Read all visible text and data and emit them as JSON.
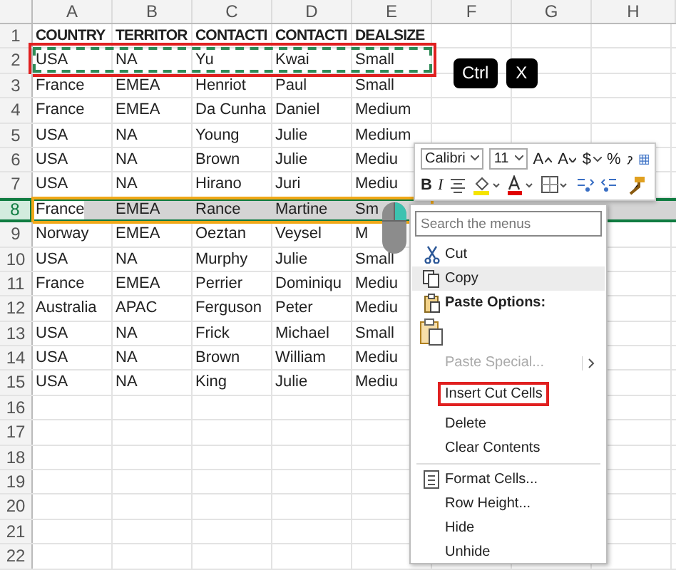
{
  "sheet": {
    "columns": [
      "A",
      "B",
      "C",
      "D",
      "E",
      "F",
      "G",
      "H"
    ],
    "header_row": {
      "number": "1",
      "cells": [
        "COUNTRY",
        "TERRITOR",
        "CONTACTI",
        "CONTACTI",
        "DEALSIZE"
      ]
    },
    "rows": [
      {
        "number": "2",
        "selected": false,
        "cut": true,
        "outlined": false,
        "cells": [
          "USA",
          "NA",
          "Yu",
          "Kwai",
          "Small"
        ]
      },
      {
        "number": "3",
        "selected": false,
        "cut": false,
        "outlined": false,
        "cells": [
          "France",
          "EMEA",
          "Henriot",
          "Paul",
          "Small"
        ]
      },
      {
        "number": "4",
        "selected": false,
        "cut": false,
        "outlined": false,
        "cells": [
          "France",
          "EMEA",
          "Da Cunha",
          "Daniel",
          "Medium"
        ]
      },
      {
        "number": "5",
        "selected": false,
        "cut": false,
        "outlined": false,
        "cells": [
          "USA",
          "NA",
          "Young",
          "Julie",
          "Medium"
        ]
      },
      {
        "number": "6",
        "selected": false,
        "cut": false,
        "outlined": false,
        "cells": [
          "USA",
          "NA",
          "Brown",
          "Julie",
          "Mediu"
        ]
      },
      {
        "number": "7",
        "selected": false,
        "cut": false,
        "outlined": false,
        "cells": [
          "USA",
          "NA",
          "Hirano",
          "Juri",
          "Mediu"
        ]
      },
      {
        "number": "8",
        "selected": true,
        "cut": false,
        "outlined": true,
        "cells": [
          "France",
          "EMEA",
          "Rance",
          "Martine",
          "Sm"
        ]
      },
      {
        "number": "9",
        "selected": false,
        "cut": false,
        "outlined": false,
        "cells": [
          "Norway",
          "EMEA",
          "Oeztan",
          "Veysel",
          "M"
        ]
      },
      {
        "number": "10",
        "selected": false,
        "cut": false,
        "outlined": false,
        "cells": [
          "USA",
          "NA",
          "Murphy",
          "Julie",
          "Small"
        ]
      },
      {
        "number": "11",
        "selected": false,
        "cut": false,
        "outlined": false,
        "cells": [
          "France",
          "EMEA",
          "Perrier",
          "Dominiqu",
          "Mediu"
        ]
      },
      {
        "number": "12",
        "selected": false,
        "cut": false,
        "outlined": false,
        "cells": [
          "Australia",
          "APAC",
          "Ferguson",
          "Peter",
          "Mediu"
        ]
      },
      {
        "number": "13",
        "selected": false,
        "cut": false,
        "outlined": false,
        "cells": [
          "USA",
          "NA",
          "Frick",
          "Michael",
          "Small"
        ]
      },
      {
        "number": "14",
        "selected": false,
        "cut": false,
        "outlined": false,
        "cells": [
          "USA",
          "NA",
          "Brown",
          "William",
          "Mediu"
        ]
      },
      {
        "number": "15",
        "selected": false,
        "cut": false,
        "outlined": false,
        "cells": [
          "USA",
          "NA",
          "King",
          "Julie",
          "Mediu"
        ]
      },
      {
        "number": "16",
        "selected": false,
        "cut": false,
        "outlined": false,
        "cells": []
      },
      {
        "number": "17",
        "selected": false,
        "cut": false,
        "outlined": false,
        "cells": []
      },
      {
        "number": "18",
        "selected": false,
        "cut": false,
        "outlined": false,
        "cells": []
      },
      {
        "number": "19",
        "selected": false,
        "cut": false,
        "outlined": false,
        "cells": []
      },
      {
        "number": "20",
        "selected": false,
        "cut": false,
        "outlined": false,
        "cells": []
      },
      {
        "number": "21",
        "selected": false,
        "cut": false,
        "outlined": false,
        "cells": []
      },
      {
        "number": "22",
        "selected": false,
        "cut": false,
        "outlined": false,
        "cells": []
      }
    ]
  },
  "shortcut_keys": [
    "Ctrl",
    "X"
  ],
  "mini_toolbar": {
    "font": "Calibri",
    "size": "11",
    "row1": [
      {
        "kind": "grow",
        "label": "A"
      },
      {
        "kind": "shrink",
        "label": "A"
      },
      {
        "kind": "text-dropdown",
        "label": "$"
      },
      {
        "kind": "text",
        "label": "%"
      },
      {
        "kind": "comma"
      },
      {
        "kind": "table"
      }
    ],
    "row2": [
      {
        "kind": "bold",
        "label": "B"
      },
      {
        "kind": "italic",
        "label": "I"
      },
      {
        "kind": "align"
      },
      {
        "kind": "fill"
      },
      {
        "kind": "font-color"
      },
      {
        "kind": "borders"
      },
      {
        "kind": "decimal-more"
      },
      {
        "kind": "decimal-less"
      },
      {
        "kind": "painter"
      }
    ]
  },
  "context_menu": {
    "search": {
      "placeholder": "Search the menus"
    },
    "items": [
      {
        "kind": "cut",
        "label": "Cut",
        "selected": false,
        "disabled": false,
        "outlined": false
      },
      {
        "kind": "copy",
        "label": "Copy",
        "selected": true,
        "disabled": false,
        "outlined": false
      },
      {
        "kind": "heading",
        "label": "Paste Options:",
        "selected": false,
        "disabled": false,
        "outlined": false
      },
      {
        "kind": "paste",
        "selected": false,
        "disabled": false,
        "outlined": false
      },
      {
        "kind": "submenu",
        "label": "Paste Special...",
        "selected": false,
        "disabled": true,
        "outlined": false
      },
      {
        "kind": "plain",
        "label": "Insert Cut Cells",
        "selected": false,
        "disabled": false,
        "outlined": true
      },
      {
        "kind": "plain",
        "label": "Delete",
        "selected": false,
        "disabled": false,
        "outlined": false
      },
      {
        "kind": "plain",
        "label": "Clear Contents",
        "selected": false,
        "disabled": false,
        "outlined": false
      },
      {
        "kind": "separator"
      },
      {
        "kind": "format",
        "label": "Format Cells...",
        "selected": false,
        "disabled": false,
        "outlined": false
      },
      {
        "kind": "plain",
        "label": "Row Height...",
        "selected": false,
        "disabled": false,
        "outlined": false
      },
      {
        "kind": "plain",
        "label": "Hide",
        "selected": false,
        "disabled": false,
        "outlined": false
      },
      {
        "kind": "plain",
        "label": "Unhide",
        "selected": false,
        "disabled": false,
        "outlined": false
      }
    ]
  }
}
